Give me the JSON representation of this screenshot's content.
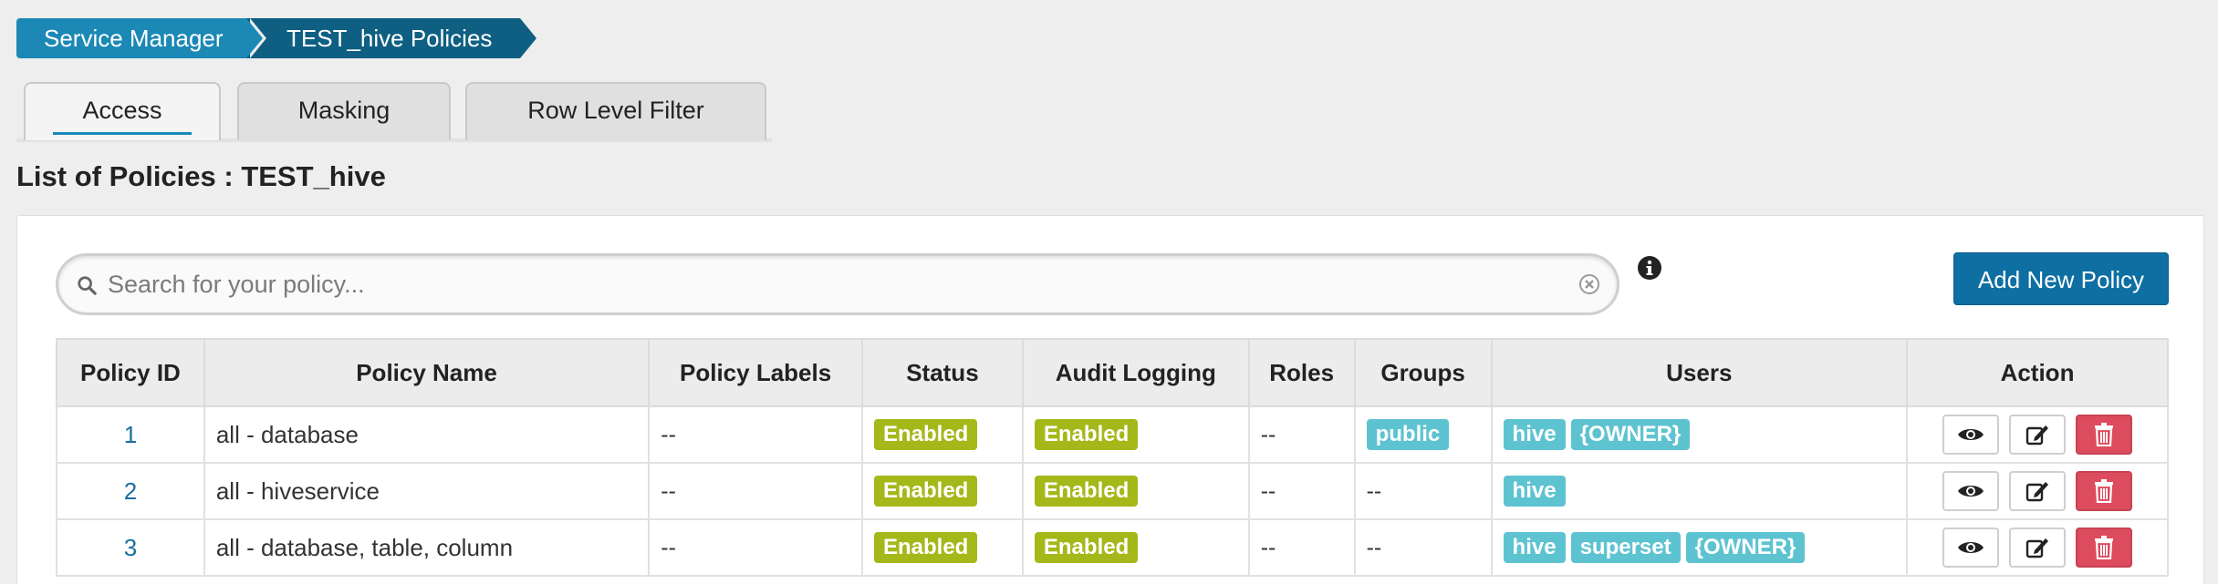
{
  "breadcrumb": {
    "items": [
      "Service Manager",
      "TEST_hive Policies"
    ]
  },
  "tabs": [
    {
      "label": "Access",
      "active": true
    },
    {
      "label": "Masking",
      "active": false
    },
    {
      "label": "Row Level Filter",
      "active": false
    }
  ],
  "page_title": "List of Policies : TEST_hive",
  "search": {
    "placeholder": "Search for your policy...",
    "value": ""
  },
  "add_button": "Add New Policy",
  "table": {
    "headers": [
      "Policy ID",
      "Policy Name",
      "Policy Labels",
      "Status",
      "Audit Logging",
      "Roles",
      "Groups",
      "Users",
      "Action"
    ],
    "rows": [
      {
        "id": "1",
        "name": "all - database",
        "labels": "--",
        "status": "Enabled",
        "audit": "Enabled",
        "roles": "--",
        "groups": [
          "public"
        ],
        "users": [
          "hive",
          "{OWNER}"
        ]
      },
      {
        "id": "2",
        "name": "all - hiveservice",
        "labels": "--",
        "status": "Enabled",
        "audit": "Enabled",
        "roles": "--",
        "groups_text": "--",
        "users": [
          "hive"
        ]
      },
      {
        "id": "3",
        "name": "all - database, table, column",
        "labels": "--",
        "status": "Enabled",
        "audit": "Enabled",
        "roles": "--",
        "groups_text": "--",
        "users": [
          "hive",
          "superset",
          "{OWNER}"
        ]
      }
    ]
  },
  "colors": {
    "accent": "#1b88b5",
    "accent_dark": "#0e5f82",
    "enabled": "#a4b81a",
    "tag": "#5ec3d1",
    "delete": "#dd4b5e"
  }
}
